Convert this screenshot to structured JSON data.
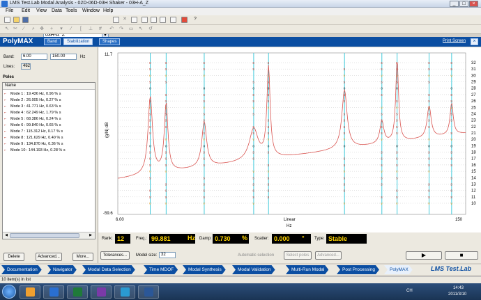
{
  "window": {
    "title": "LMS Test.Lab Modal Analysis - 02D-06D-03H Shaker - 03H-A_Z",
    "min": "_",
    "max": "□",
    "close": "×"
  },
  "menu": [
    "File",
    "Edit",
    "View",
    "Data",
    "Tools",
    "Window",
    "Help"
  ],
  "toolbar": {
    "project": "03H-A_Z"
  },
  "polymax": {
    "title": "PolyMAX",
    "tabs": [
      "Band",
      "Stabilization",
      "Shapes"
    ],
    "active_tab": "Stabilization",
    "print_screen": "Print Screen"
  },
  "band": {
    "label": "Band:",
    "from": "6.00",
    "to": "150.00",
    "unit": "Hz",
    "lines_label": "Lines:",
    "lines": "462"
  },
  "poles": {
    "header": "Poles",
    "column": "Name",
    "items": [
      "Mode 1 : 19.436 Hz, 0.96 %  s",
      "Mode 2 : 26.005 Hz, 0.27 %  s",
      "Mode 3 : 41.771 Hz, 0.63 %  s",
      "Mode 4 : 62.249 Hz, 1.79 %  s",
      "Mode 5 : 68.386 Hz, 0.24 %  s",
      "Mode 6 : 99.840 Hz, 0.65 %  s",
      "Mode 7 : 115.312 Hz, 0.17 %  s",
      "Mode 8 : 121.629 Hz, 0.40 %  s",
      "Mode 9 : 134.870 Hz, 0.36 %  s",
      "Mode 10 : 144.193 Hz, 0.28 %  s"
    ]
  },
  "buttons": {
    "delete": "Delete",
    "advanced": "Advanced...",
    "more": "More..."
  },
  "chart": {
    "y_top": "11.7",
    "y_bottom": "-59.6",
    "y_label": "(g/N) dB",
    "x_left": "6.00",
    "x_right": "150",
    "x_scale": "Linear",
    "x_unit": "Hz",
    "right_ticks": [
      "32",
      "31",
      "30",
      "29",
      "28",
      "27",
      "26",
      "25",
      "24",
      "23",
      "22",
      "21",
      "20",
      "19",
      "18",
      "17",
      "16",
      "15",
      "14",
      "13",
      "12",
      "11",
      "10"
    ]
  },
  "results": {
    "rank_label": "Rank:",
    "rank": "12",
    "freq_label": "Freq.:",
    "freq": "99.881",
    "freq_unit": "Hz",
    "damp_label": "Damp:",
    "damp": "0.730",
    "damp_unit": "%",
    "scatter_label": "Scatter:",
    "scatter": "0.000",
    "scatter_unit": "°",
    "type_label": "Type:",
    "type": "Stable"
  },
  "controls": {
    "tolerances": "Tolerances...",
    "model_size_label": "Model size:",
    "model_size": "32",
    "auto_label": "Automatic selection",
    "select_poles": "Select poles",
    "advanced": "Advanced..."
  },
  "workflow": {
    "items": [
      "Documentation",
      "Navigator",
      "Modal Data Selection",
      "Time MDOF",
      "Modal Synthesis",
      "Modal Validation",
      "Multi-Run Modal",
      "Post Processing",
      "PolyMAX"
    ],
    "active": "PolyMAX",
    "brand": "LMS Test.Lab"
  },
  "status": {
    "text": "10 item(s) in list"
  },
  "taskbar": {
    "time": "14:43",
    "date": "2011/3/10",
    "lang": "CH"
  },
  "chart_data": {
    "type": "line",
    "xlim": [
      6,
      150
    ],
    "ylim": [
      -59.6,
      11.7
    ],
    "xlabel": "Hz",
    "ylabel": "(g/N) dB",
    "peaks_hz": [
      19.436,
      26.005,
      41.771,
      62.249,
      68.386,
      99.84,
      115.312,
      121.629,
      134.87,
      144.193
    ]
  }
}
